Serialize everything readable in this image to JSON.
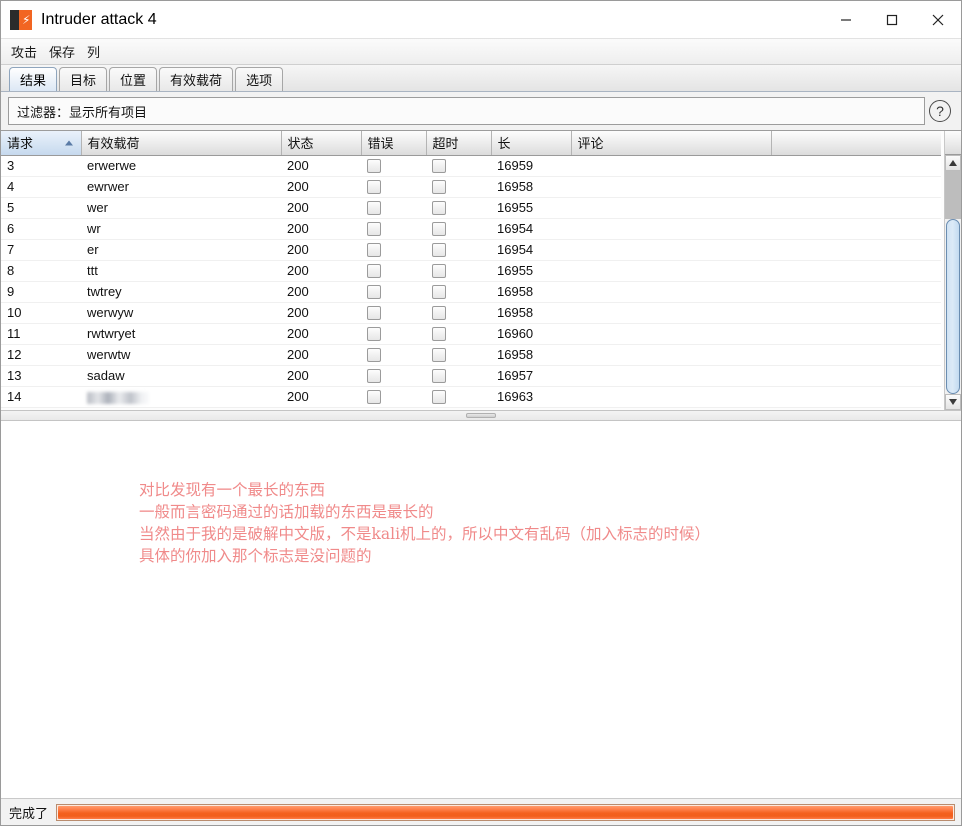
{
  "window": {
    "title": "Intruder attack 4",
    "icon": "burp-suite-icon",
    "minimize_label": "–",
    "maximize_label": "□",
    "close_label": "✕"
  },
  "menu": {
    "items": [
      {
        "label": "攻击",
        "name": "menu-attack"
      },
      {
        "label": "保存",
        "name": "menu-save"
      },
      {
        "label": "列",
        "name": "menu-columns"
      }
    ]
  },
  "tabs": {
    "active_index": 0,
    "items": [
      {
        "label": "结果",
        "name": "tab-results"
      },
      {
        "label": "目标",
        "name": "tab-target"
      },
      {
        "label": "位置",
        "name": "tab-positions"
      },
      {
        "label": "有效载荷",
        "name": "tab-payloads"
      },
      {
        "label": "选项",
        "name": "tab-options"
      }
    ]
  },
  "filter": {
    "label": "过滤器：显示所有项目",
    "help_icon": "question-mark-icon",
    "help_label": "?"
  },
  "table": {
    "sorted_column_index": 0,
    "sort_direction": "ascending",
    "columns": [
      {
        "label": "请求",
        "key": "request"
      },
      {
        "label": "有效载荷",
        "key": "payload"
      },
      {
        "label": "状态",
        "key": "status"
      },
      {
        "label": "错误",
        "key": "error"
      },
      {
        "label": "超时",
        "key": "timeout"
      },
      {
        "label": "长",
        "key": "length"
      },
      {
        "label": "评论",
        "key": "comment"
      }
    ],
    "rows": [
      {
        "request": "3",
        "payload": "erwerwe",
        "status": "200",
        "error": false,
        "timeout": false,
        "length": "16959",
        "comment": "",
        "redacted": false
      },
      {
        "request": "4",
        "payload": "ewrwer",
        "status": "200",
        "error": false,
        "timeout": false,
        "length": "16958",
        "comment": "",
        "redacted": false
      },
      {
        "request": "5",
        "payload": "wer",
        "status": "200",
        "error": false,
        "timeout": false,
        "length": "16955",
        "comment": "",
        "redacted": false
      },
      {
        "request": "6",
        "payload": "wr",
        "status": "200",
        "error": false,
        "timeout": false,
        "length": "16954",
        "comment": "",
        "redacted": false
      },
      {
        "request": "7",
        "payload": "er",
        "status": "200",
        "error": false,
        "timeout": false,
        "length": "16954",
        "comment": "",
        "redacted": false
      },
      {
        "request": "8",
        "payload": "ttt",
        "status": "200",
        "error": false,
        "timeout": false,
        "length": "16955",
        "comment": "",
        "redacted": false
      },
      {
        "request": "9",
        "payload": "twtrey",
        "status": "200",
        "error": false,
        "timeout": false,
        "length": "16958",
        "comment": "",
        "redacted": false
      },
      {
        "request": "10",
        "payload": "werwyw",
        "status": "200",
        "error": false,
        "timeout": false,
        "length": "16958",
        "comment": "",
        "redacted": false
      },
      {
        "request": "11",
        "payload": "rwtwryet",
        "status": "200",
        "error": false,
        "timeout": false,
        "length": "16960",
        "comment": "",
        "redacted": false
      },
      {
        "request": "12",
        "payload": "werwtw",
        "status": "200",
        "error": false,
        "timeout": false,
        "length": "16958",
        "comment": "",
        "redacted": false
      },
      {
        "request": "13",
        "payload": "sadaw",
        "status": "200",
        "error": false,
        "timeout": false,
        "length": "16957",
        "comment": "",
        "redacted": false
      },
      {
        "request": "14",
        "payload": "",
        "status": "200",
        "error": false,
        "timeout": false,
        "length": "16963",
        "comment": "",
        "redacted": true
      }
    ]
  },
  "annotation": {
    "color": "#f08a8a",
    "lines": [
      "对比发现有一个最长的东西",
      "一般而言密码通过的话加载的东西是最长的",
      "当然由于我的是破解中文版，不是kali机上的，所以中文有乱码（加入标志的时候）",
      "具体的你加入那个标志是没问题的"
    ]
  },
  "statusbar": {
    "text": "完成了",
    "progress_percent": 100,
    "progress_color": "#f4601e"
  }
}
